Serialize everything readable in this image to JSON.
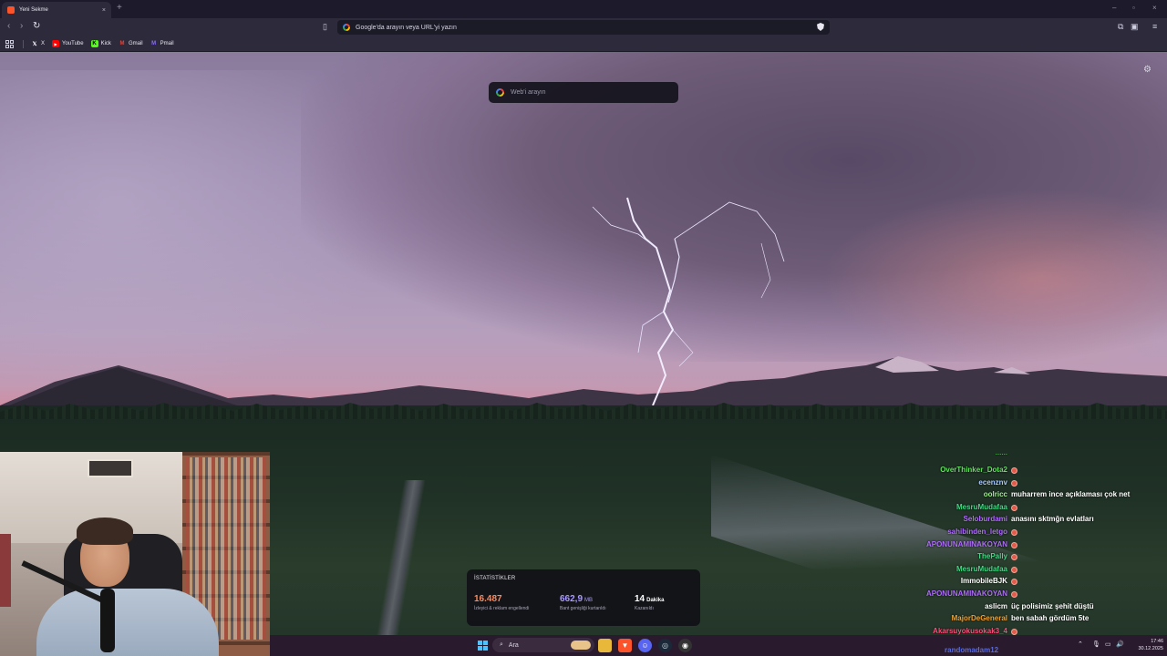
{
  "browser": {
    "tab": {
      "title": "Yeni Sekme",
      "close_glyph": "×"
    },
    "new_tab_glyph": "+",
    "window_controls": [
      "–",
      "▫",
      "×"
    ],
    "nav": {
      "back": "‹",
      "forward": "›",
      "reload": "↻"
    },
    "omnibox_placeholder": "Google'da arayın veya URL'yi yazın",
    "bookmarks": [
      {
        "label": "X",
        "icon": "x-icon",
        "color": "#ffffff"
      },
      {
        "label": "YouTube",
        "icon": "youtube-icon",
        "color": "#ff0000"
      },
      {
        "label": "Kick",
        "icon": "kick-icon",
        "color": "#53fc18"
      },
      {
        "label": "Gmail",
        "icon": "gmail-icon",
        "color": "#ea4335"
      },
      {
        "label": "Pmail",
        "icon": "pmail-icon",
        "color": "#8b6cf6"
      }
    ]
  },
  "newtab": {
    "search_placeholder": "Web'i arayın",
    "stats": {
      "heading": "İSTATİSTİKLER",
      "items": [
        {
          "value": "16.487",
          "unit": "",
          "label": "İzleyici & reklam engellendi",
          "color": "#ff8a5c"
        },
        {
          "value": "662,9",
          "unit": "MB",
          "label": "Bant genişliği kurtarıldı",
          "color": "#a99bff"
        },
        {
          "value": "14",
          "unit": "Dakika",
          "label": "Kazanıldı",
          "color": "#ffffff"
        }
      ]
    }
  },
  "chat": {
    "partial_top": "......",
    "messages": [
      {
        "user": "OverThinker_Dota2",
        "color": "#5ee35a",
        "text": ""
      },
      {
        "user": "ecenznv",
        "color": "#a8c8ff",
        "text": ""
      },
      {
        "user": "oolricc",
        "color": "#9df28a",
        "text": "muharrem ince açıklaması çok net"
      },
      {
        "user": "MesruMudafaa",
        "color": "#3ddc84",
        "text": ""
      },
      {
        "user": "Seloburdami",
        "color": "#b06cff",
        "text": "anasını sktmğn evlatları"
      },
      {
        "user": "sahibinden_letgo",
        "color": "#b06cff",
        "text": ""
      },
      {
        "user": "APONUNAMINAKOYAN",
        "color": "#b06cff",
        "text": ""
      },
      {
        "user": "ThePally",
        "color": "#3ddc84",
        "text": ""
      },
      {
        "user": "MesruMudafaa",
        "color": "#3ddc84",
        "text": ""
      },
      {
        "user": "ImmobileBJK",
        "color": "#ffffff",
        "text": ""
      },
      {
        "user": "APONUNAMINAKOYAN",
        "color": "#b06cff",
        "text": ""
      },
      {
        "user": "aslicm",
        "color": "#ffffff",
        "text": "üç polisimiz şehit düştü"
      },
      {
        "user": "MajorDeGeneral",
        "color": "#f3a12a",
        "text": "ben sabah gördüm 5te"
      },
      {
        "user": "Akarsuyokusokak3_4",
        "color": "#ff4f7a",
        "text": ""
      }
    ],
    "next_user": "randomadam12"
  },
  "taskbar": {
    "search_label": "Ara",
    "clock_time": "17:46",
    "clock_date": "30.12.2025"
  }
}
